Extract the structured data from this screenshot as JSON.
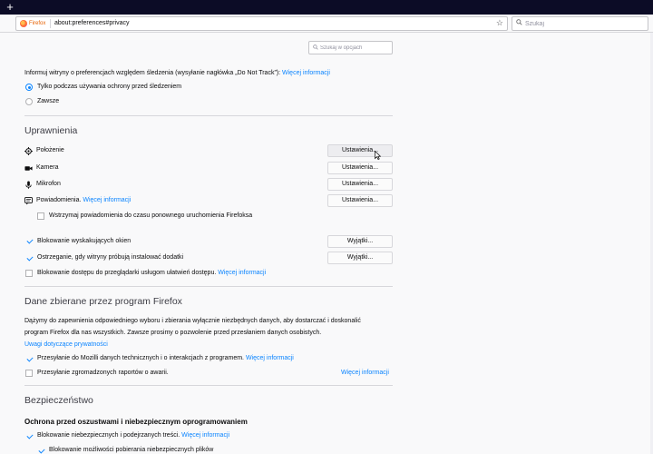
{
  "browser": {
    "identity_label": "Firefox",
    "url": "about:preferences#privacy",
    "search_placeholder": "Szukaj",
    "new_tab_label": "+"
  },
  "prefs": {
    "search_placeholder": "Szukaj w opcjach",
    "dnt": {
      "text": "Informuj witryny o preferencjach względem śledzenia (wysyłanie nagłówka „Do Not Track”):",
      "link": "Więcej informacji",
      "options": [
        {
          "label": "Tylko podczas używania ochrony przed śledzeniem",
          "selected": true
        },
        {
          "label": "Zawsze",
          "selected": false
        }
      ]
    },
    "permissions": {
      "heading": "Uprawnienia",
      "items": [
        {
          "label": "Położenie",
          "icon": "location-icon",
          "button": "Ustawienia..."
        },
        {
          "label": "Kamera",
          "icon": "camera-icon",
          "button": "Ustawienia..."
        },
        {
          "label": "Mikrofon",
          "icon": "microphone-icon",
          "button": "Ustawienia..."
        },
        {
          "label": "Powiadomienia.",
          "icon": "notifications-icon",
          "button": "Ustawienia...",
          "link": "Więcej informacji"
        }
      ],
      "pause_notifications": {
        "label": "Wstrzymaj powiadomienia do czasu ponownego uruchomienia Firefoksa",
        "checked": false
      },
      "block_popups": {
        "label": "Blokowanie wyskakujących okien",
        "checked": true,
        "button": "Wyjątki..."
      },
      "warn_addons": {
        "label": "Ostrzeganie, gdy witryny próbują instalować dodatki",
        "checked": true,
        "button": "Wyjątki..."
      },
      "block_a11y": {
        "label": "Blokowanie dostępu do przeglądarki usługom ułatwień dostępu.",
        "checked": false,
        "link": "Więcej informacji"
      }
    },
    "data_collection": {
      "heading": "Dane zbierane przez program Firefox",
      "para_line1": "Dążymy do zapewnienia odpowiedniego wyboru i zbierania wyłącznie niezbędnych danych, aby dostarczać i doskonalić",
      "para_line2": "program Firefox dla nas wszystkich. Zawsze prosimy o pozwolenie przed przesłaniem danych osobistych.",
      "privacy_link": "Uwagi dotyczące prywatności",
      "technical": {
        "label": "Przesyłanie do Mozilli danych technicznych i o interakcjach z programem.",
        "checked": true,
        "link": "Więcej informacji"
      },
      "crash": {
        "label": "Przesyłanie zgromadzonych raportów o awarii.",
        "checked": false,
        "link": "Więcej informacji"
      }
    },
    "security": {
      "heading": "Bezpieczeństwo",
      "subheading": "Ochrona przed oszustwami i niebezpiecznym oprogramowaniem",
      "block_dangerous": {
        "label": "Blokowanie niebezpiecznych i podejrzanych treści.",
        "checked": true,
        "link": "Więcej informacji"
      },
      "block_downloads": {
        "label": "Blokowanie możliwości pobierania niebezpiecznych plików",
        "checked": true
      }
    }
  }
}
